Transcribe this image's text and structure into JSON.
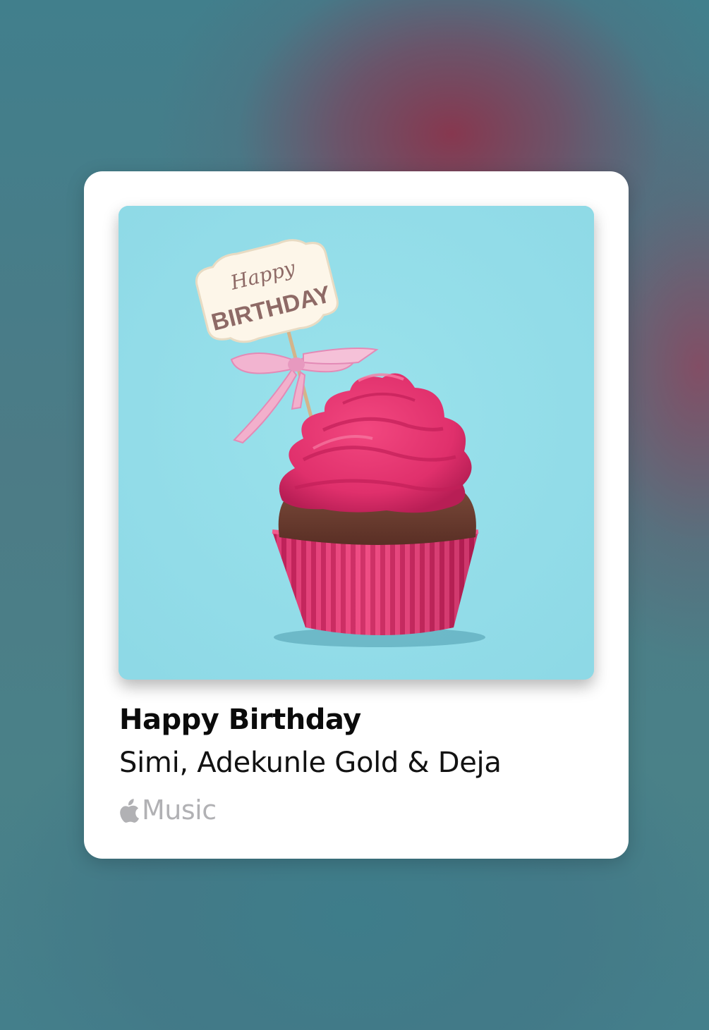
{
  "share_card": {
    "song_title": "Happy Birthday",
    "artist": "Simi, Adekunle Gold & Deja",
    "service": {
      "label": "Music",
      "icon": "apple-logo-icon"
    },
    "artwork": {
      "topper_script": "Happy",
      "topper_text": "BIRTHDAY",
      "background_color": "#93dde9",
      "frosting_color": "#e4316f",
      "liner_color": "#e22d69"
    }
  }
}
